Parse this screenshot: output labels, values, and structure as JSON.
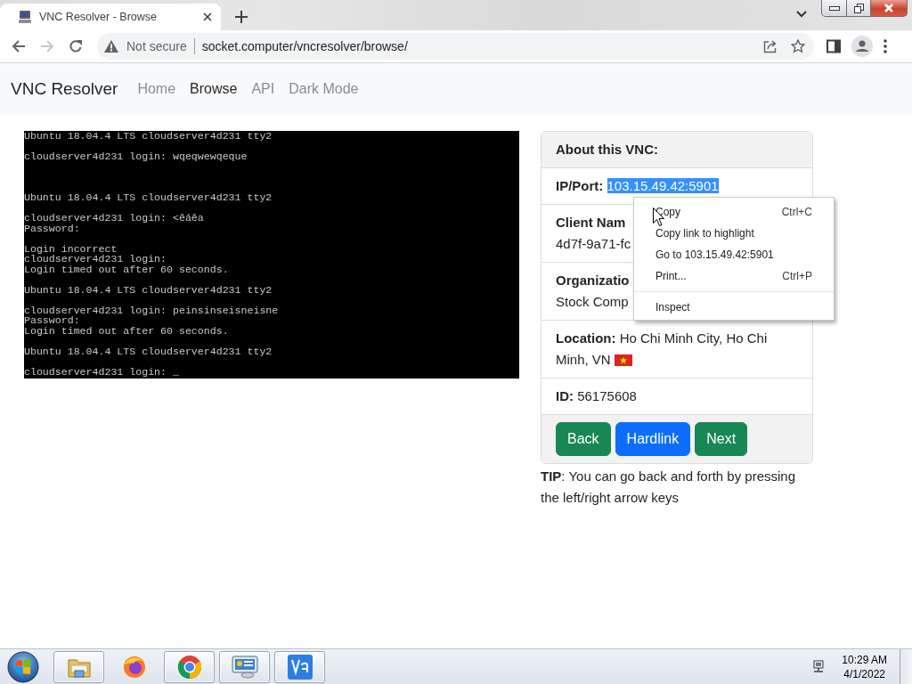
{
  "browser": {
    "tab": {
      "title": "VNC Resolver - Browse",
      "selected": true
    },
    "forward": {
      "disabled": true
    },
    "security_label": "Not secure",
    "url": "socket.computer/vncresolver/browse/"
  },
  "navbar": {
    "brand": "VNC Resolver",
    "links": [
      {
        "label": "Home",
        "selected": false
      },
      {
        "label": "Browse",
        "selected": true
      },
      {
        "label": "API",
        "selected": false
      },
      {
        "label": "Dark Mode",
        "selected": false
      }
    ]
  },
  "terminal": {
    "groups": [
      [
        "Ubuntu 18.04.4 LTS cloudserver4d231 tty2"
      ],
      [
        "cloudserver4d231 login: wqeqwewqeque"
      ],
      [
        "Ubuntu 18.04.4 LTS cloudserver4d231 tty2"
      ],
      [
        "cloudserver4d231 login: <êáêa",
        "Password:"
      ],
      [
        "Login incorrect",
        "cloudserver4d231 login:",
        "Login timed out after 60 seconds."
      ],
      [
        "Ubuntu 18.04.4 LTS cloudserver4d231 tty2"
      ],
      [
        "cloudserver4d231 login: peinsinseisneisne",
        "Password:",
        "Login timed out after 60 seconds."
      ],
      [
        "Ubuntu 18.04.4 LTS cloudserver4d231 tty2"
      ],
      [
        "cloudserver4d231 login: _"
      ]
    ]
  },
  "info_card": {
    "title": "About this VNC:",
    "items": [
      {
        "kind": "pair",
        "label": "IP/Port:",
        "value": "103.15.49.42:5901",
        "highlighted": true
      },
      {
        "kind": "stacked",
        "label": "Client Nam",
        "value": "4d7f-9a71-fc"
      },
      {
        "kind": "stacked",
        "label": "Organizatio",
        "value": "Stock Comp"
      },
      {
        "kind": "wrapped",
        "label": "Location:",
        "lines": [
          "Ho Chi Minh City, Ho Chi",
          "Minh, VN"
        ],
        "flag": true
      },
      {
        "kind": "inline",
        "label": "ID:",
        "value": "56175608"
      }
    ],
    "buttons": [
      {
        "label": "Back",
        "kind": "success"
      },
      {
        "label": "Hardlink",
        "kind": "primary"
      },
      {
        "label": "Next",
        "kind": "success"
      }
    ]
  },
  "tip": "**TIP**: You can go back and forth by pressing the left/right arrow keys",
  "context_menu": {
    "groups": [
      [
        {
          "label": "Copy",
          "shortcut": "Ctrl+C"
        },
        {
          "label": "Copy link to highlight"
        },
        {
          "label": "Go to 103.15.49.42:5901"
        },
        {
          "label": "Print...",
          "shortcut": "Ctrl+P"
        }
      ],
      [
        {
          "label": "Inspect"
        }
      ]
    ]
  },
  "taskbar": {
    "apps": [
      {
        "kind": "explorer",
        "running": true
      },
      {
        "kind": "firefox",
        "running": false
      },
      {
        "kind": "chrome",
        "running": true
      },
      {
        "kind": "control_panel",
        "running": true
      },
      {
        "kind": "vnc_viewer",
        "running": true
      }
    ],
    "clock": {
      "time": "10:29 AM",
      "date": "4/1/2022"
    }
  }
}
